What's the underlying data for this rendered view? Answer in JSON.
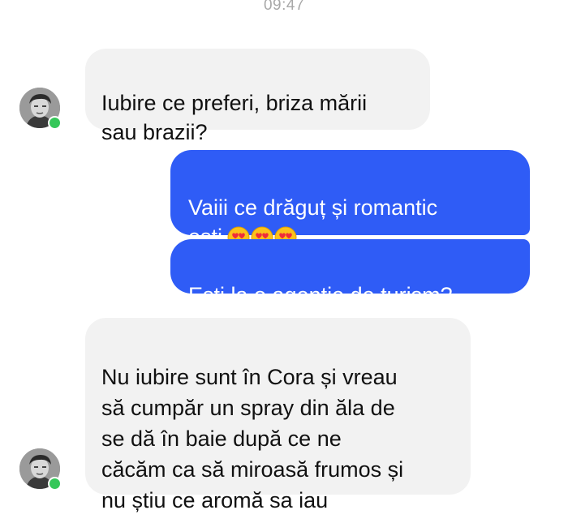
{
  "status_bar": {
    "time": "09:47"
  },
  "conversation": {
    "messages": [
      {
        "direction": "incoming",
        "text": "Iubire ce preferi, briza mării\nsau brazii?"
      },
      {
        "direction": "outgoing",
        "text": "Vaiii ce drăguț și romantic\nești",
        "emoji": "heart-eyes-icon",
        "emoji_count": 3
      },
      {
        "direction": "outgoing",
        "text": "Ești la o agenție de turism?"
      },
      {
        "direction": "incoming",
        "text": "Nu iubire sunt în Cora și vreau\nsă cumpăr un spray din ăla de\nse dă în baie după ce ne\ncăcăm ca să miroasă frumos și\nnu știu ce aromă sa iau"
      }
    ]
  },
  "colors": {
    "outgoing_bubble": "#2f5cf6",
    "incoming_bubble": "#f2f2f2",
    "online_indicator": "#35c759",
    "timestamp": "#a8a8a8"
  }
}
